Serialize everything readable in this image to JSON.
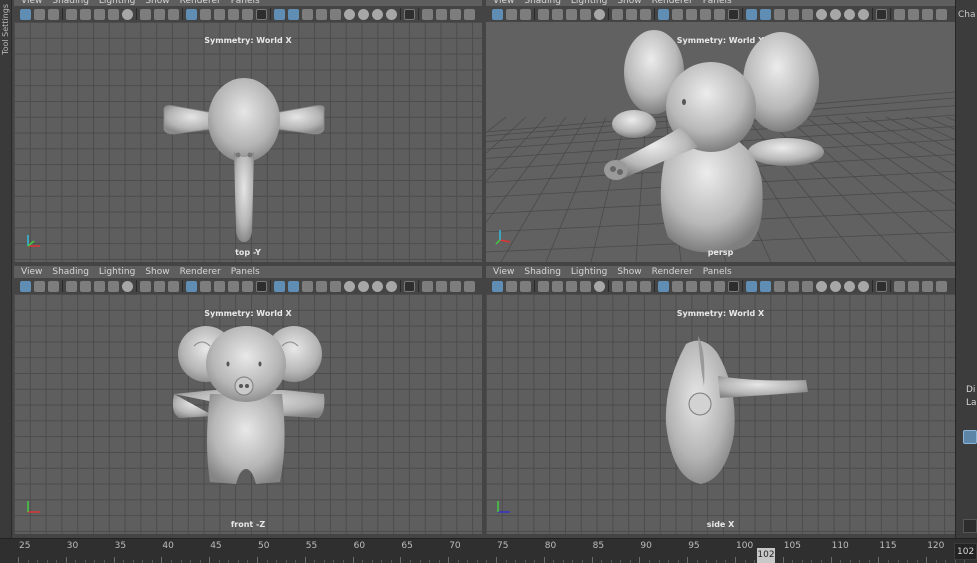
{
  "left_strip": {
    "label": "Tool Settings"
  },
  "right_strip": {
    "tab": "Cha",
    "label_1": "Di",
    "label_2": "La"
  },
  "menu_items": [
    "View",
    "Shading",
    "Lighting",
    "Show",
    "Renderer",
    "Panels"
  ],
  "viewports": {
    "top": {
      "symmetry": "Symmetry: World X",
      "label": "top -Y"
    },
    "persp": {
      "symmetry": "Symmetry: World X",
      "label": "persp"
    },
    "front": {
      "symmetry": "Symmetry: World X",
      "label": "front -Z"
    },
    "side": {
      "symmetry": "Symmetry: World X",
      "label": "side X"
    }
  },
  "timeline": {
    "ticks": [
      "25",
      "30",
      "35",
      "40",
      "45",
      "50",
      "55",
      "60",
      "65",
      "70",
      "75",
      "80",
      "85",
      "90",
      "95",
      "100",
      "105",
      "110",
      "115",
      "120"
    ],
    "current_frame": "102",
    "frame_field": "102"
  },
  "colors": {
    "viewport_bg": "#5e5e5e",
    "grid": "#4c4c4c",
    "toolbar_active": "#5f8db3",
    "model": "#bdbdbd"
  },
  "icons": [
    "select-icon",
    "camera-icon",
    "grid-icon",
    "wireframe-icon",
    "smooth-shade-icon",
    "lights-icon",
    "isolate-icon"
  ]
}
